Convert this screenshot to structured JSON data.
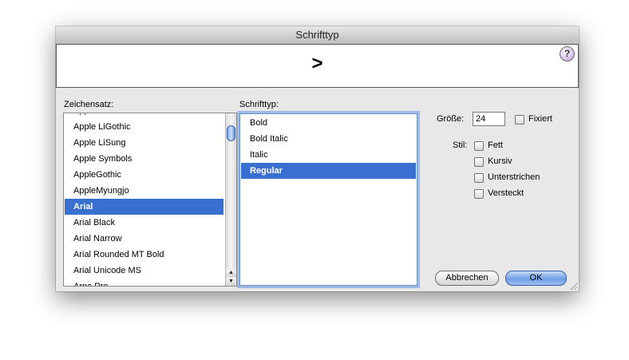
{
  "window": {
    "title": "Schrifttyp"
  },
  "preview": {
    "sample_text": ">",
    "help_label": "?"
  },
  "font_family_list": {
    "label": "Zeichensatz:",
    "items": [
      "Apple LiGothic",
      "Apple LiSung",
      "Apple Symbols",
      "AppleGothic",
      "AppleMyungjo",
      "Arial",
      "Arial Black",
      "Arial Narrow",
      "Arial Rounded MT Bold",
      "Arial Unicode MS",
      "Arno Pro"
    ],
    "selected": "Arial"
  },
  "typeface_list": {
    "label": "Schrifttyp:",
    "items": [
      "Bold",
      "Bold Italic",
      "Italic",
      "Regular"
    ],
    "selected": "Regular"
  },
  "size": {
    "label": "Größe:",
    "value": "24",
    "fixed_label": "Fixiert"
  },
  "style": {
    "label": "Stil:",
    "options": [
      "Fett",
      "Kursiv",
      "Unterstrichen",
      "Versteckt"
    ]
  },
  "buttons": {
    "cancel": "Abbrechen",
    "ok": "OK"
  },
  "colors": {
    "selection": "#3a6fd2",
    "focus_ring": "#9cbbe6",
    "default_button": "#6f9fe6"
  }
}
